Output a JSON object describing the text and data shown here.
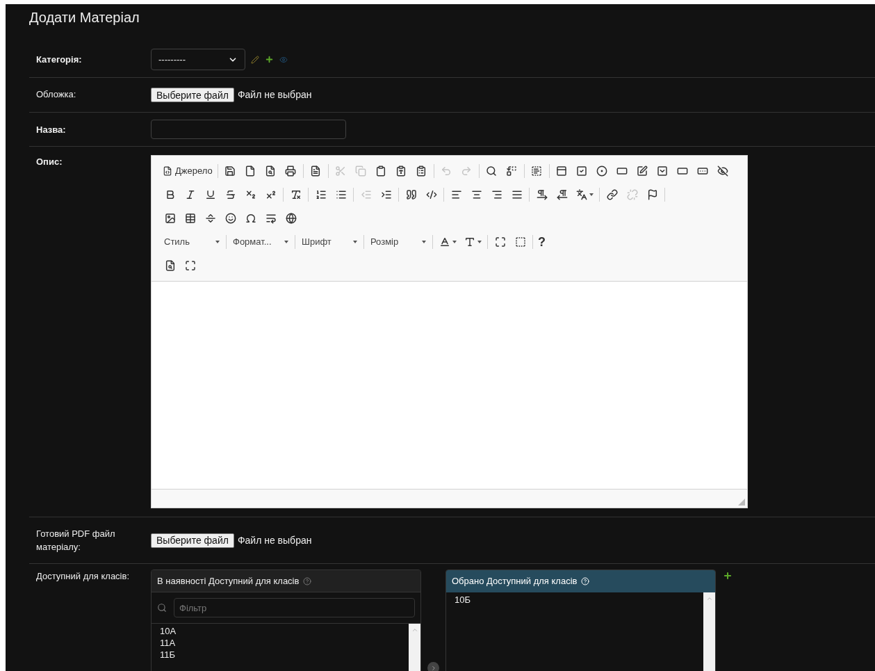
{
  "title": "Додати Матеріал",
  "fields": [
    {
      "kind": "select",
      "label": "Категорія:",
      "required": true,
      "value": "---------"
    },
    {
      "kind": "file",
      "label": "Обложка:",
      "required": false,
      "button": "Выберите файл",
      "status": "Файл не выбран"
    },
    {
      "kind": "text",
      "label": "Назва:",
      "required": true
    },
    {
      "kind": "editor",
      "label": "Опис:",
      "required": true,
      "toolbar": [
        [
          {
            "kind": "text",
            "label": "Джерело"
          },
          {
            "kind": "sep"
          },
          {
            "kind": "icon",
            "disabled": false
          },
          {
            "kind": "icon",
            "disabled": false
          },
          {
            "kind": "icon",
            "disabled": false
          },
          {
            "kind": "icon",
            "disabled": false
          },
          {
            "kind": "sep"
          },
          {
            "kind": "icon",
            "disabled": false
          },
          {
            "kind": "sep"
          },
          {
            "kind": "icon",
            "disabled": true
          },
          {
            "kind": "icon",
            "disabled": true
          },
          {
            "kind": "icon",
            "disabled": false
          },
          {
            "kind": "icon",
            "disabled": false
          },
          {
            "kind": "icon",
            "disabled": false
          },
          {
            "kind": "sep"
          },
          {
            "kind": "icon",
            "disabled": true
          },
          {
            "kind": "icon",
            "disabled": true
          },
          {
            "kind": "sep"
          },
          {
            "kind": "icon",
            "disabled": false
          },
          {
            "kind": "icon",
            "disabled": false
          },
          {
            "kind": "sep"
          },
          {
            "kind": "icon",
            "disabled": false
          },
          {
            "kind": "sep"
          },
          {
            "kind": "icon",
            "disabled": false
          },
          {
            "kind": "icon",
            "disabled": false
          },
          {
            "kind": "icon",
            "disabled": false
          },
          {
            "kind": "icon",
            "disabled": false
          },
          {
            "kind": "icon",
            "disabled": false
          },
          {
            "kind": "icon",
            "disabled": false
          },
          {
            "kind": "icon",
            "disabled": false
          },
          {
            "kind": "icon",
            "disabled": false
          },
          {
            "kind": "icon",
            "disabled": false
          }
        ],
        [
          {
            "kind": "icon",
            "disabled": false
          },
          {
            "kind": "icon",
            "disabled": false
          },
          {
            "kind": "icon",
            "disabled": false
          },
          {
            "kind": "icon",
            "disabled": false
          },
          {
            "kind": "icon",
            "disabled": false
          },
          {
            "kind": "icon",
            "disabled": false
          },
          {
            "kind": "sep"
          },
          {
            "kind": "icon",
            "disabled": false
          },
          {
            "kind": "sep"
          },
          {
            "kind": "icon",
            "disabled": false
          },
          {
            "kind": "icon",
            "disabled": false
          },
          {
            "kind": "sep"
          },
          {
            "kind": "icon",
            "disabled": true
          },
          {
            "kind": "icon",
            "disabled": false
          },
          {
            "kind": "sep"
          },
          {
            "kind": "icon",
            "disabled": false
          },
          {
            "kind": "icon",
            "disabled": false
          },
          {
            "kind": "sep"
          },
          {
            "kind": "icon",
            "disabled": false
          },
          {
            "kind": "icon",
            "disabled": false
          },
          {
            "kind": "icon",
            "disabled": false
          },
          {
            "kind": "icon",
            "disabled": false
          },
          {
            "kind": "sep"
          },
          {
            "kind": "icon",
            "disabled": false
          },
          {
            "kind": "icon",
            "disabled": false
          },
          {
            "kind": "menu-icon",
            "disabled": false
          },
          {
            "kind": "sep"
          },
          {
            "kind": "icon",
            "disabled": false
          },
          {
            "kind": "icon",
            "disabled": true
          },
          {
            "kind": "icon",
            "disabled": false
          },
          {
            "kind": "sep"
          }
        ],
        [
          {
            "kind": "icon",
            "disabled": false
          },
          {
            "kind": "icon",
            "disabled": false
          },
          {
            "kind": "icon",
            "disabled": false
          },
          {
            "kind": "icon",
            "disabled": false
          },
          {
            "kind": "icon",
            "disabled": false
          },
          {
            "kind": "icon",
            "disabled": false
          },
          {
            "kind": "icon",
            "disabled": false
          }
        ],
        [
          {
            "kind": "combo",
            "label": "Стиль"
          },
          {
            "kind": "sep"
          },
          {
            "kind": "combo",
            "label": "Формат..."
          },
          {
            "kind": "sep"
          },
          {
            "kind": "combo",
            "label": "Шрифт"
          },
          {
            "kind": "sep"
          },
          {
            "kind": "combo",
            "label": "Розмір"
          },
          {
            "kind": "sep"
          },
          {
            "kind": "menu-icon",
            "disabled": false
          },
          {
            "kind": "menu-icon",
            "disabled": false
          },
          {
            "kind": "sep"
          },
          {
            "kind": "icon",
            "disabled": false
          },
          {
            "kind": "icon",
            "disabled": false
          },
          {
            "kind": "sep"
          },
          {
            "kind": "text",
            "label": "?"
          }
        ],
        [
          {
            "kind": "icon",
            "disabled": false
          },
          {
            "kind": "icon",
            "disabled": false
          }
        ]
      ]
    },
    {
      "kind": "file",
      "label": "Готовий PDF файл матеріалу:",
      "required": false,
      "button": "Выберите файл",
      "status": "Файл не выбран"
    },
    {
      "kind": "multiselect",
      "label": "Доступний для класів:",
      "required": false,
      "available": {
        "title": "В наявності Доступний для класів",
        "filter_placeholder": "Фільтр",
        "items": [
          "10А",
          "11А",
          "11Б"
        ]
      },
      "chosen": {
        "title": "Обрано Доступний для класів",
        "items": [
          "10Б"
        ]
      }
    }
  ]
}
